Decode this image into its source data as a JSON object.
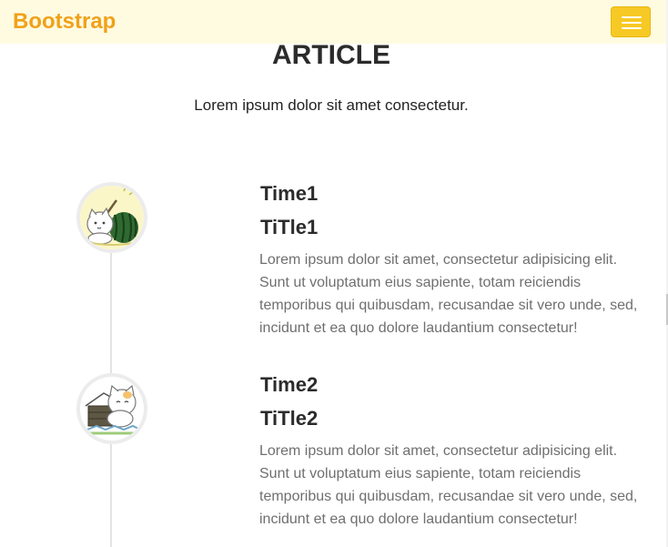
{
  "navbar": {
    "brand": "Bootstrap",
    "toggle_icon": "hamburger-menu-icon",
    "brand_color": "#f0a11a",
    "background": "#fffbe0",
    "toggle_color": "#f7c925"
  },
  "article": {
    "heading": "ARTICLE",
    "subheading": "Lorem ipsum dolor sit amet consectetur."
  },
  "timeline": [
    {
      "time": "Time1",
      "title": "TiTle1",
      "image": "cat-with-watermelon-image",
      "body": "Lorem ipsum dolor sit amet, consectetur adipisicing elit. Sunt ut voluptatum eius sapiente, totam reiciendis temporibus qui quibusdam, recusandae sit vero unde, sed, incidunt et ea quo dolore laudantium consectetur!"
    },
    {
      "time": "Time2",
      "title": "TiTle2",
      "image": "cat-with-house-image",
      "body": "Lorem ipsum dolor sit amet, consectetur adipisicing elit. Sunt ut voluptatum eius sapiente, totam reiciendis temporibus qui quibusdam, recusandae sit vero unde, sed, incidunt et ea quo dolore laudantium consectetur!"
    }
  ]
}
